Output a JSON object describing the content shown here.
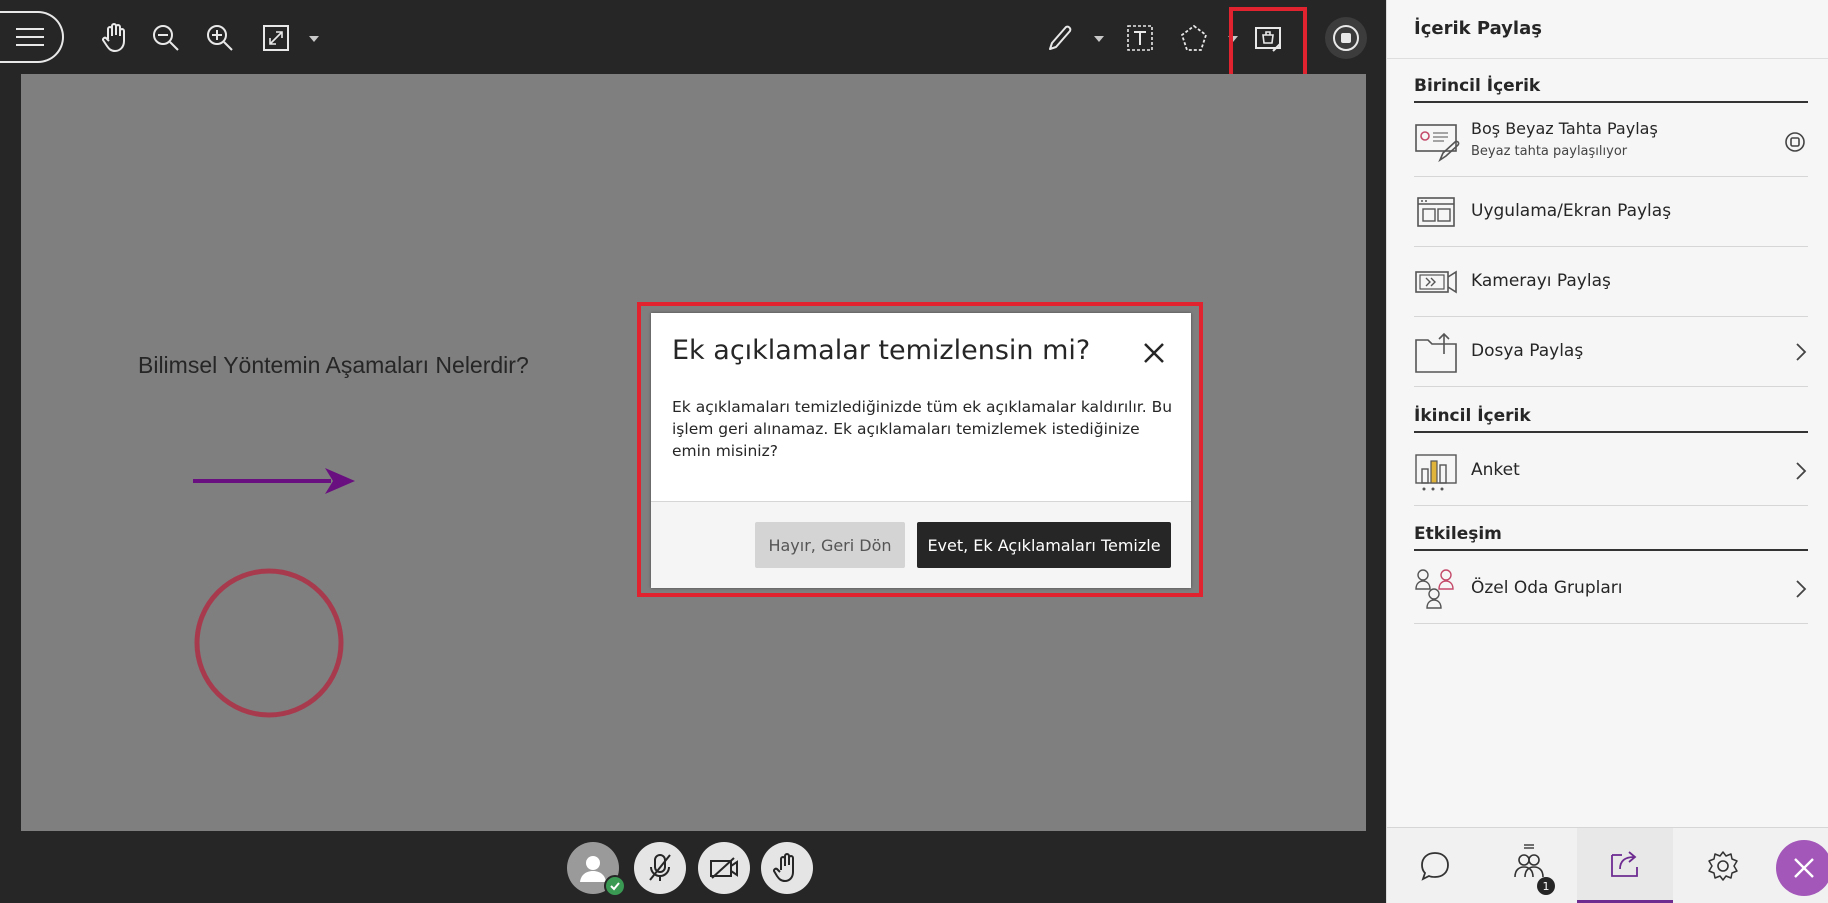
{
  "whiteboard": {
    "question_text": "Bilimsel Yöntemin Aşamaları Nelerdir?"
  },
  "dialog": {
    "title": "Ek açıklamalar temizlensin mi?",
    "body": "Ek açıklamaları temizlediğinizde tüm ek açıklamalar kaldırılır. Bu işlem geri alınamaz. Ek açıklamaları temizlemek istediğinize emin misiniz?",
    "cancel_label": "Hayır, Geri Dön",
    "confirm_label": "Evet, Ek Açıklamaları Temizle"
  },
  "panel": {
    "title": "İçerik Paylaş",
    "primary_section": "Birincil İçerik",
    "secondary_section": "İkincil İçerik",
    "interaction_section": "Etkileşim",
    "items": [
      {
        "label": "Boş Beyaz Tahta Paylaş",
        "sub": "Beyaz tahta paylaşılıyor",
        "icon": "whiteboard-icon"
      },
      {
        "label": "Uygulama/Ekran Paylaş",
        "icon": "screen-share-icon"
      },
      {
        "label": "Kamerayı Paylaş",
        "icon": "camera-share-icon"
      },
      {
        "label": "Dosya Paylaş",
        "icon": "file-share-icon"
      },
      {
        "label": "Anket",
        "icon": "poll-icon"
      },
      {
        "label": "Özel Oda Grupları",
        "icon": "breakout-groups-icon"
      }
    ],
    "participants_badge": "1"
  },
  "colors": {
    "accent_purple": "#6e2c91",
    "highlight_red": "#e0232f",
    "arrow_purple": "#6a0f80",
    "circle_red": "#a83a4e"
  }
}
